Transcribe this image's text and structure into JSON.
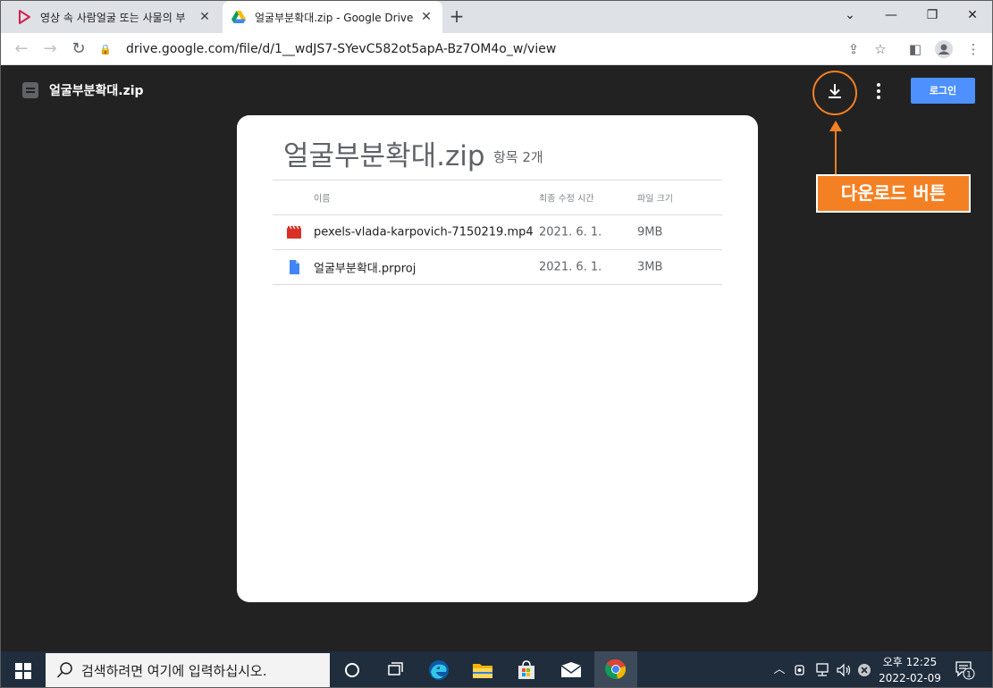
{
  "browser": {
    "tabs": [
      {
        "title": "영상 속 사람얼굴 또는 사물의 부",
        "active": false,
        "icon": "play-triangle-icon"
      },
      {
        "title": "얼굴부분확대.zip - Google Drive",
        "active": true,
        "icon": "google-drive-icon"
      }
    ],
    "url": "drive.google.com/file/d/1__wdJS7-SYevC582ot5apA-Bz7OM4o_w/view"
  },
  "viewer": {
    "title": "얼굴부분확대.zip",
    "login_label": "로그인",
    "callout_label": "다운로드 버튼"
  },
  "card": {
    "title": "얼굴부분확대.zip",
    "count": "항목 2개",
    "columns": {
      "name": "이름",
      "modified": "최종 수정 시간",
      "size": "파일 크기"
    },
    "files": [
      {
        "name": "pexels-vlada-karpovich-7150219.mp4",
        "modified": "2021. 6. 1.",
        "size": "9MB",
        "icon": "video-file-icon"
      },
      {
        "name": "얼굴부분확대.prproj",
        "modified": "2021. 6. 1.",
        "size": "3MB",
        "icon": "document-file-icon"
      }
    ]
  },
  "taskbar": {
    "search_placeholder": "검색하려면 여기에 입력하십시오.",
    "clock_time": "오후 12:25",
    "clock_date": "2022-02-09",
    "notification_count": "1"
  },
  "colors": {
    "accent_orange": "#f48024",
    "login_blue": "#4d90fe",
    "viewer_bg": "#222222"
  }
}
